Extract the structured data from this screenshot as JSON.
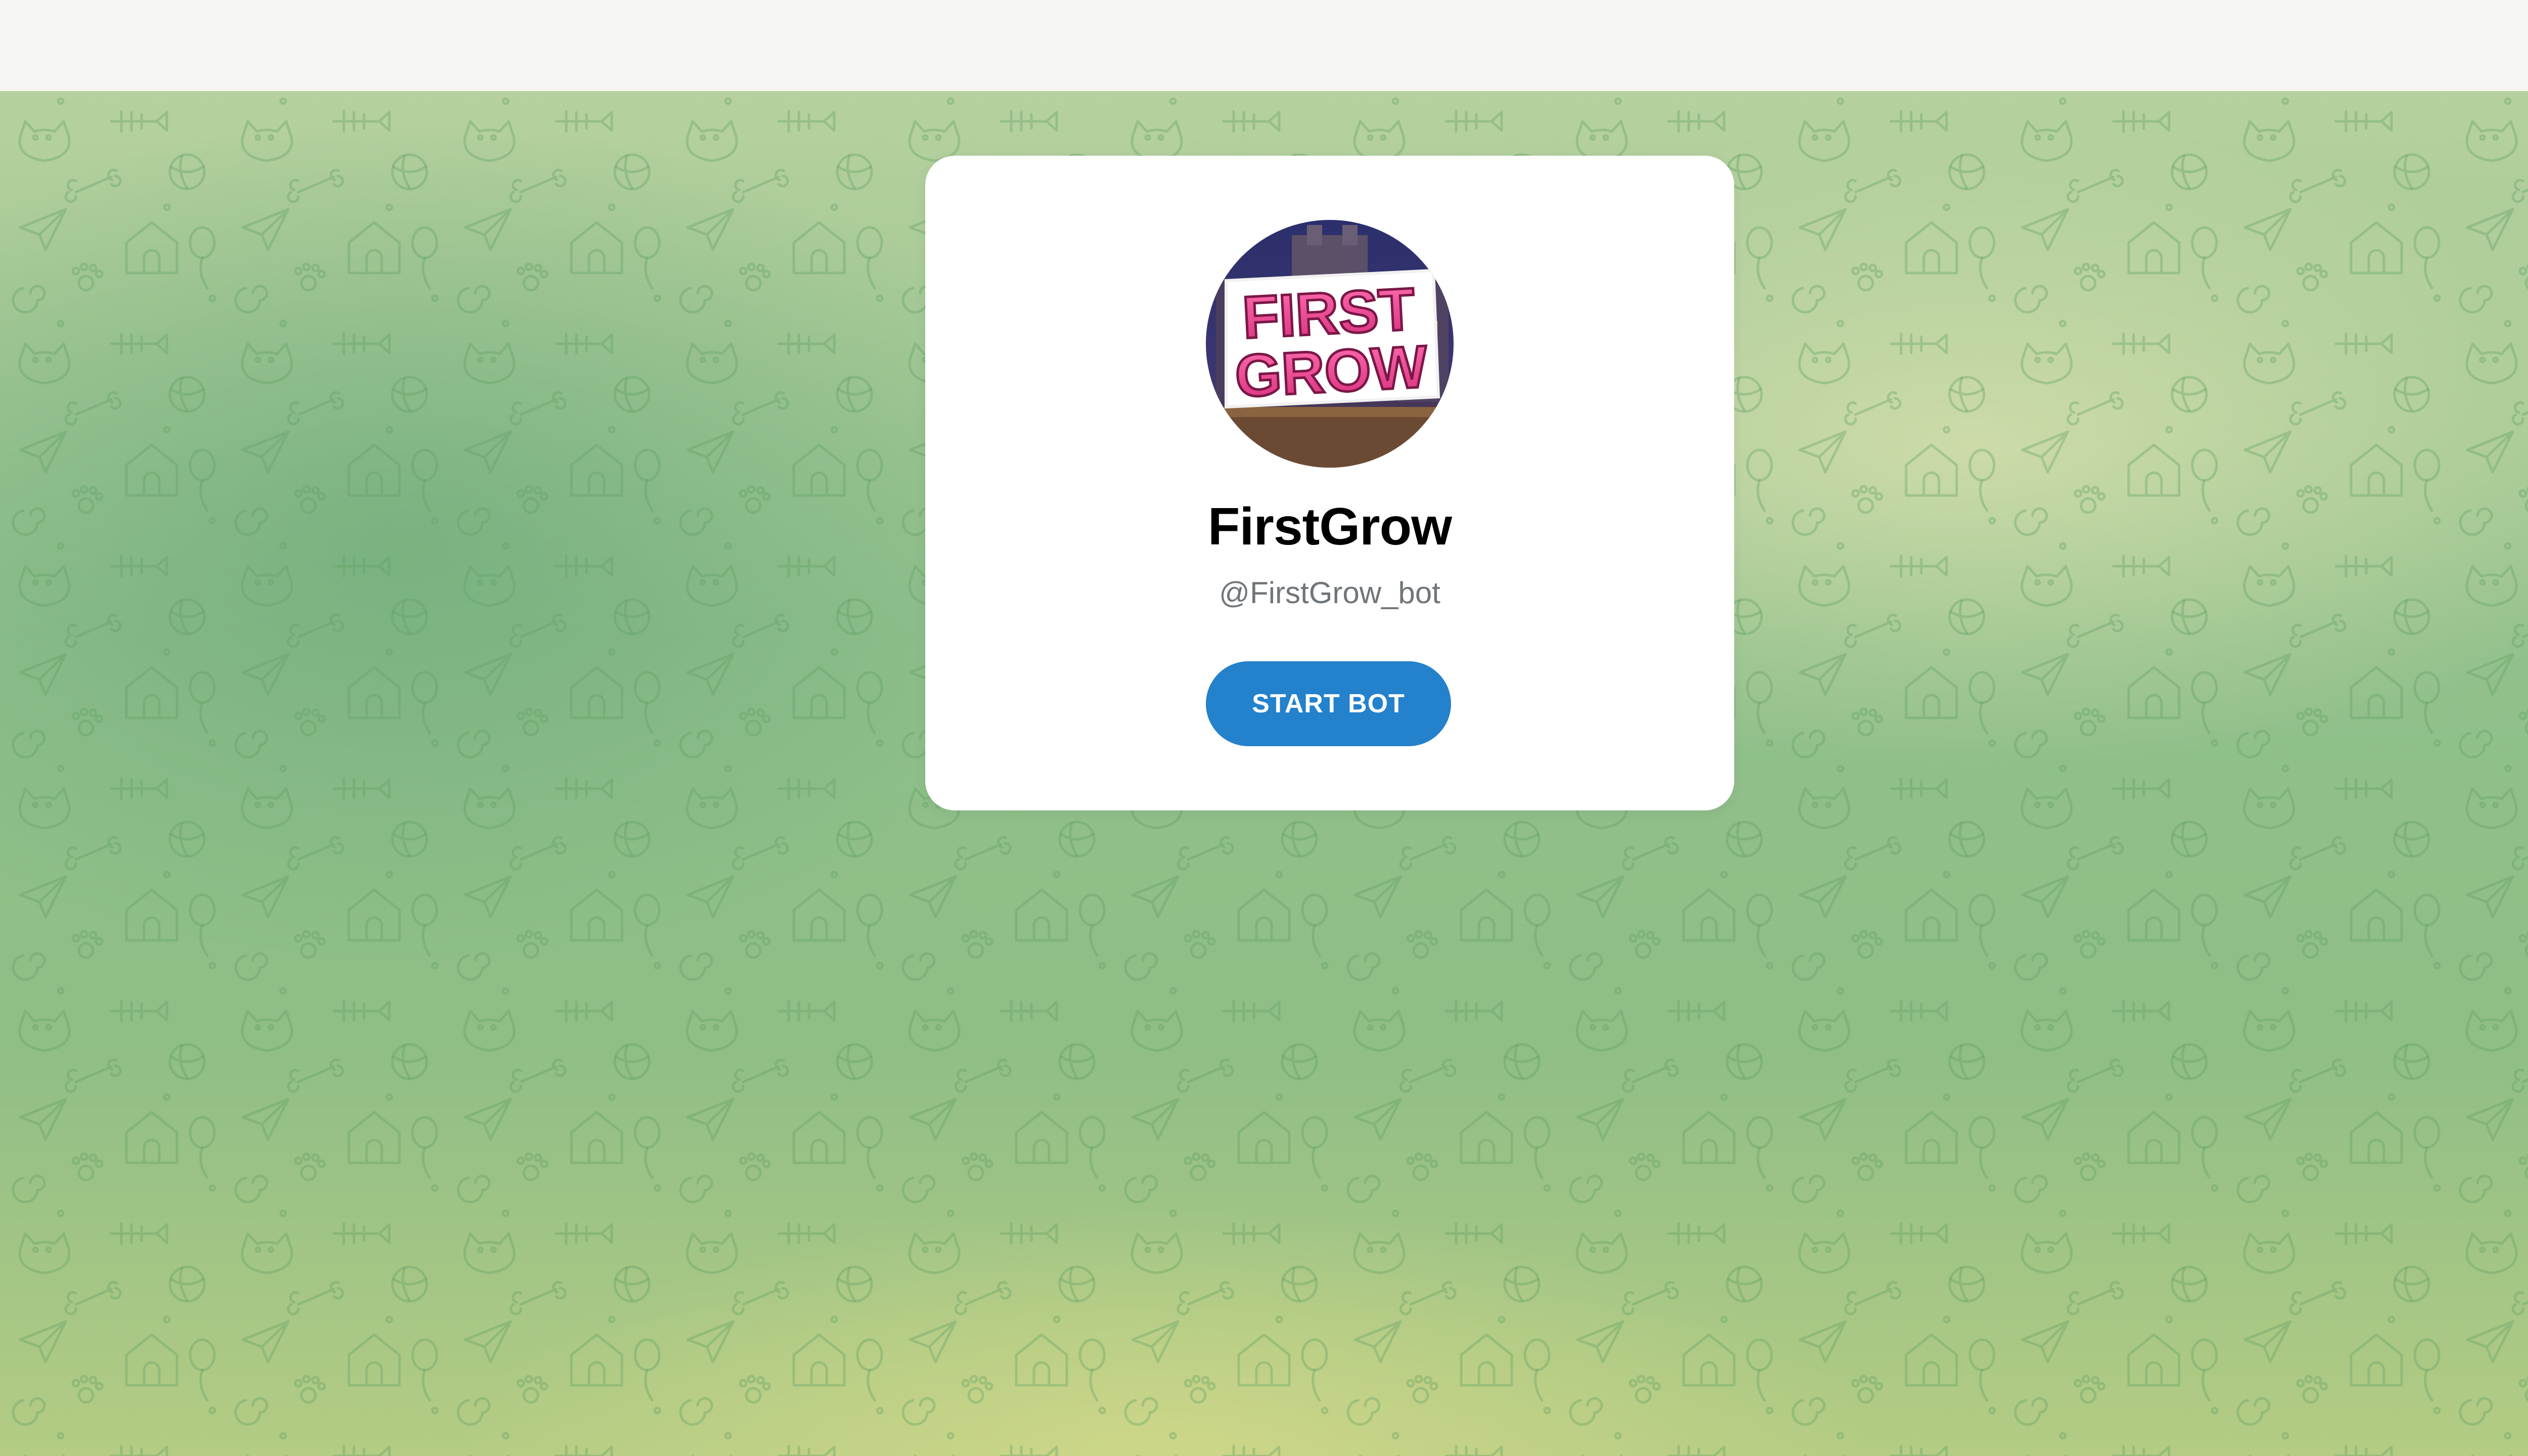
{
  "header": {},
  "bot": {
    "name": "FirstGrow",
    "username": "@FirstGrow_bot",
    "avatar_text_line1": "FIRST",
    "avatar_text_line2": "GROW"
  },
  "actions": {
    "start_label": "START BOT"
  },
  "colors": {
    "accent": "#2481cc",
    "card": "#ffffff",
    "wallpaper_green": "#8fbe86",
    "avatar_text_pink": "#e8458f"
  },
  "icons": {
    "wallpaper": "doodle-pattern",
    "avatar": "firstgrow-logo"
  }
}
